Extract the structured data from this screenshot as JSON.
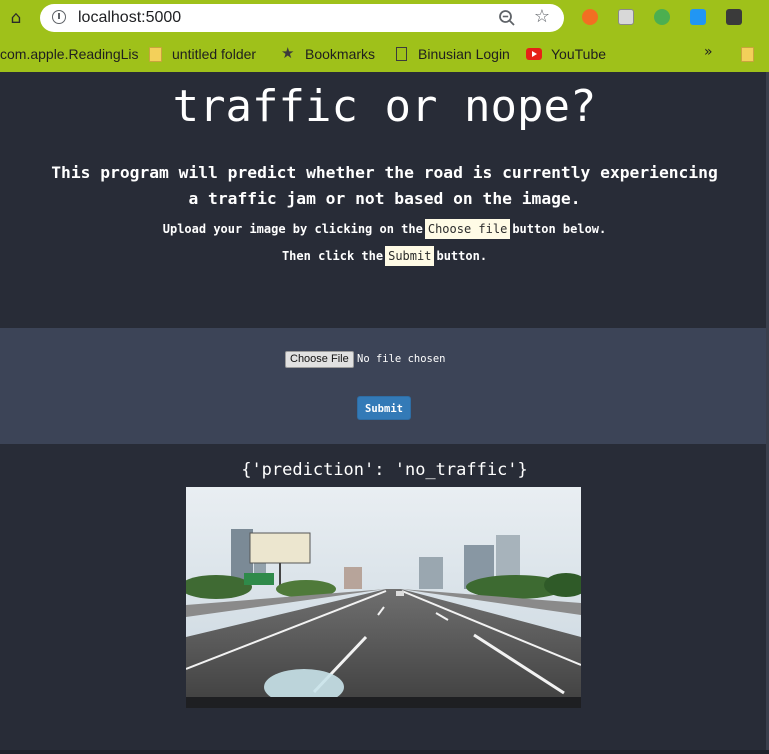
{
  "browser": {
    "url": "localhost:5000"
  },
  "bookmarks": {
    "items": [
      {
        "label": "com.apple.ReadingLis",
        "icon": "none"
      },
      {
        "label": "untitled folder",
        "icon": "folder-icon"
      },
      {
        "label": "Bookmarks",
        "icon": "star-icon"
      },
      {
        "label": "Binusian Login",
        "icon": "page-icon"
      },
      {
        "label": "YouTube",
        "icon": "youtube-icon"
      }
    ],
    "overflow": "»"
  },
  "page": {
    "title": "traffic or nope?",
    "description_line1": "This program will predict whether the road is currently experiencing",
    "description_line2": "a traffic jam or not based on the image.",
    "instruction1_prefix": "Upload your image by clicking on the",
    "instruction1_chip": "Choose file",
    "instruction1_suffix": "button below.",
    "instruction2_prefix": "Then click the",
    "instruction2_chip": "Submit",
    "instruction2_suffix": "button."
  },
  "upload": {
    "choose_button": "Choose File",
    "status": "No file chosen",
    "submit_label": "Submit"
  },
  "result": {
    "prediction_text": "{'prediction': 'no_traffic'}"
  },
  "colors": {
    "chrome_bar": "#9fc11a",
    "page_bg": "#282c37",
    "panel_bg": "#3c4457",
    "submit_bg": "#337ab7"
  }
}
